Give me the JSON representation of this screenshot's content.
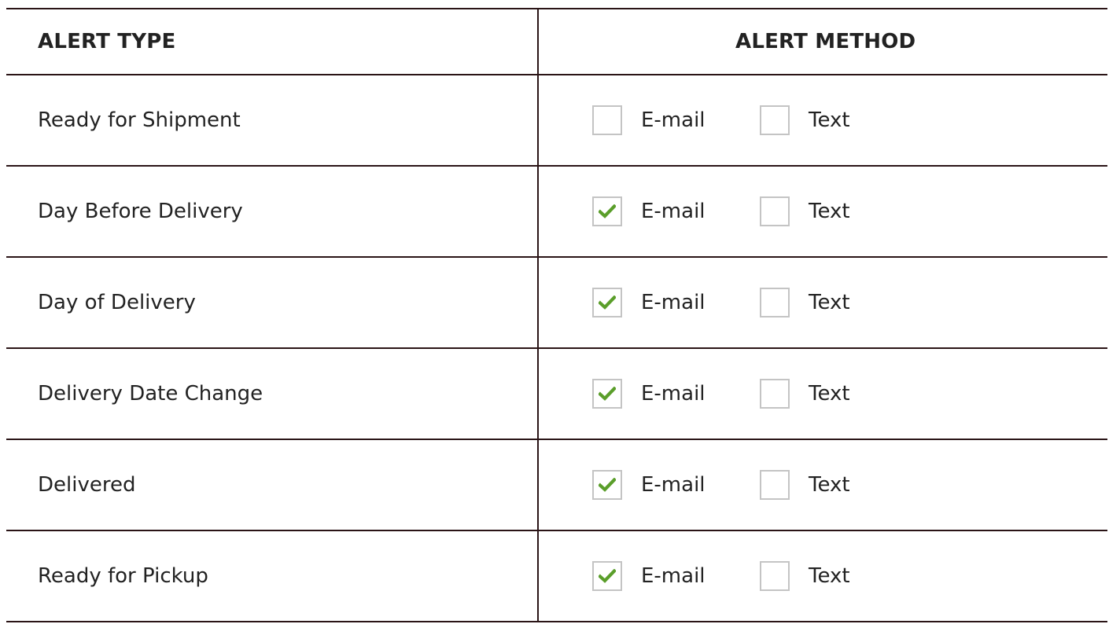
{
  "table": {
    "headers": {
      "alert_type": "ALERT TYPE",
      "alert_method": "ALERT METHOD"
    },
    "option_labels": {
      "email": "E-mail",
      "text": "Text"
    },
    "rows": [
      {
        "alert_type": "Ready for Shipment",
        "email_checked": false,
        "text_checked": false
      },
      {
        "alert_type": "Day Before Delivery",
        "email_checked": true,
        "text_checked": false
      },
      {
        "alert_type": "Day of Delivery",
        "email_checked": true,
        "text_checked": false
      },
      {
        "alert_type": "Delivery Date Change",
        "email_checked": true,
        "text_checked": false
      },
      {
        "alert_type": "Delivered",
        "email_checked": true,
        "text_checked": false
      },
      {
        "alert_type": "Ready for Pickup",
        "email_checked": true,
        "text_checked": false
      }
    ]
  },
  "colors": {
    "checkmark": "#5a9e2a",
    "checkbox_border": "#c4c4c4",
    "table_rule": "#2a1416",
    "text": "#222222"
  },
  "icons": {
    "checked": "checkmark-icon"
  }
}
